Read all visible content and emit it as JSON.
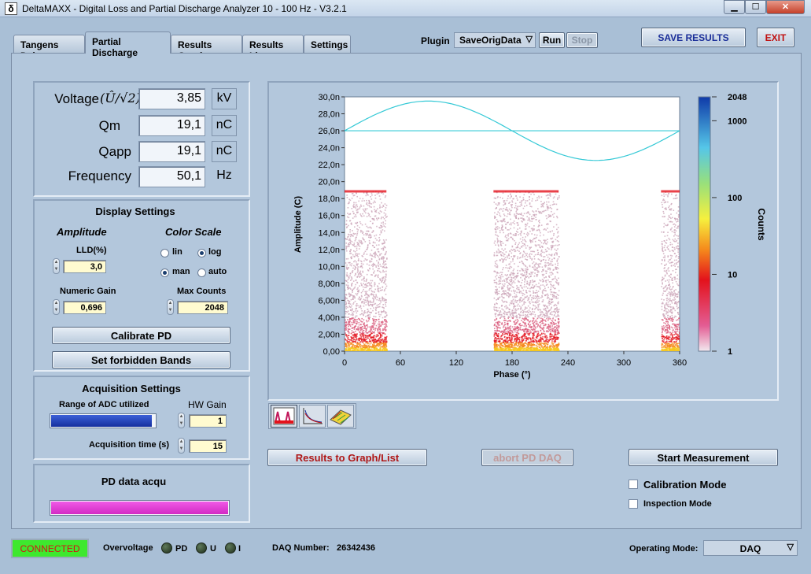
{
  "window": {
    "title": "DeltaMAXX - Digital Loss and Partial Discharge Analyzer 10 - 100 Hz - V3.2.1",
    "icon": "delta-app-icon",
    "controls": {
      "minimize": "▁",
      "maximize": "☐",
      "close": "✕"
    }
  },
  "tabs": [
    {
      "label": "Tangens Delta"
    },
    {
      "label": "Partial Discharge"
    },
    {
      "label": "Results Graph"
    },
    {
      "label": "Results List"
    },
    {
      "label": "Settings"
    }
  ],
  "toolbar": {
    "plugin_label": "Plugin",
    "plugin_value": "SaveOrigData",
    "run": "Run",
    "stop": "Stop",
    "save": "SAVE RESULTS",
    "exit": "EXIT"
  },
  "measurements": [
    {
      "label": "Voltage",
      "symbol": "(Û/√2)",
      "value": "3,85",
      "unit": "kV"
    },
    {
      "label": "Qm",
      "value": "19,1",
      "unit": "nC"
    },
    {
      "label": "Qapp",
      "value": "19,1",
      "unit": "nC"
    },
    {
      "label": "Frequency",
      "value": "50,1",
      "unit": "Hz"
    }
  ],
  "display": {
    "title": "Display Settings",
    "amplitude": "Amplitude",
    "color_scale": "Color Scale",
    "lld_label": "LLD(%)",
    "lld": "3,0",
    "lin": "lin",
    "log": "log",
    "man": "man",
    "auto": "auto",
    "gain_label": "Numeric Gain",
    "gain": "0,696",
    "maxc_label": "Max Counts",
    "maxc": "2048",
    "calibrate": "Calibrate PD",
    "bands": "Set forbidden Bands",
    "scale_selected": "log",
    "mode_selected": "man"
  },
  "acq": {
    "title": "Acquisition Settings",
    "adc_label": "Range of ADC utilized",
    "adc_fill": 0.97,
    "hwgain_label": "HW Gain",
    "hwgain": "1",
    "time_label": "Acquisition time (s)",
    "time": "15"
  },
  "pd": {
    "title": "PD data acqu",
    "progress": 1.0
  },
  "chart_data": {
    "type": "heatmap",
    "xlabel": "Phase (°)",
    "ylabel": "Amplitude (C)",
    "xticks": [
      "0",
      "60",
      "120",
      "180",
      "240",
      "300",
      "360"
    ],
    "yticks": [
      "0,00",
      "2,00n",
      "4,00n",
      "6,00n",
      "8,00n",
      "10,0n",
      "12,0n",
      "14,0n",
      "16,0n",
      "18,0n",
      "20,0n",
      "22,0n",
      "24,0n",
      "26,0n",
      "28,0n",
      "30,0n"
    ],
    "xlim": [
      0,
      360
    ],
    "ylim": [
      0,
      30
    ],
    "color_label": "Counts",
    "color_ticks": [
      "2048",
      "1000",
      "100",
      "10",
      "1"
    ],
    "color_scale": "log",
    "color_range": [
      1,
      2048
    ],
    "clusters": [
      {
        "phase": [
          0,
          45
        ],
        "max_amp": 18.9
      },
      {
        "phase": [
          160,
          230
        ],
        "max_amp": 18.9
      },
      {
        "phase": [
          340,
          360
        ],
        "max_amp": 18.9
      }
    ],
    "reference_sine": {
      "center": 26,
      "amplitude": 3.5,
      "period": 360
    },
    "reference_line": 26,
    "series_color": "#35c9d6"
  },
  "chart_tools": [
    {
      "icon": "pd-pattern-icon"
    },
    {
      "icon": "decay-curve-icon"
    },
    {
      "icon": "3d-surface-icon"
    }
  ],
  "actions": {
    "results": "Results to Graph/List",
    "abort": "abort PD DAQ",
    "start": "Start Measurement",
    "calib": "Calibration Mode",
    "inspect": "Inspection Mode"
  },
  "status": {
    "connected": "CONNECTED",
    "overvoltage": "Overvoltage",
    "pd": "PD",
    "u": "U",
    "i": "I",
    "daq_label": "DAQ Number:",
    "daq": "26342436",
    "opmode_label": "Operating Mode:",
    "opmode": "DAQ"
  },
  "colors": {
    "accent": "#1a2e99",
    "save_text": "#1a2e99",
    "exit_text": "#c01010",
    "results_text": "#b01818",
    "connected_bg": "#3ee82e",
    "connected_text": "#d11414",
    "pd_bar": "#e63ad8",
    "adc_bar": "#1a3db0"
  }
}
